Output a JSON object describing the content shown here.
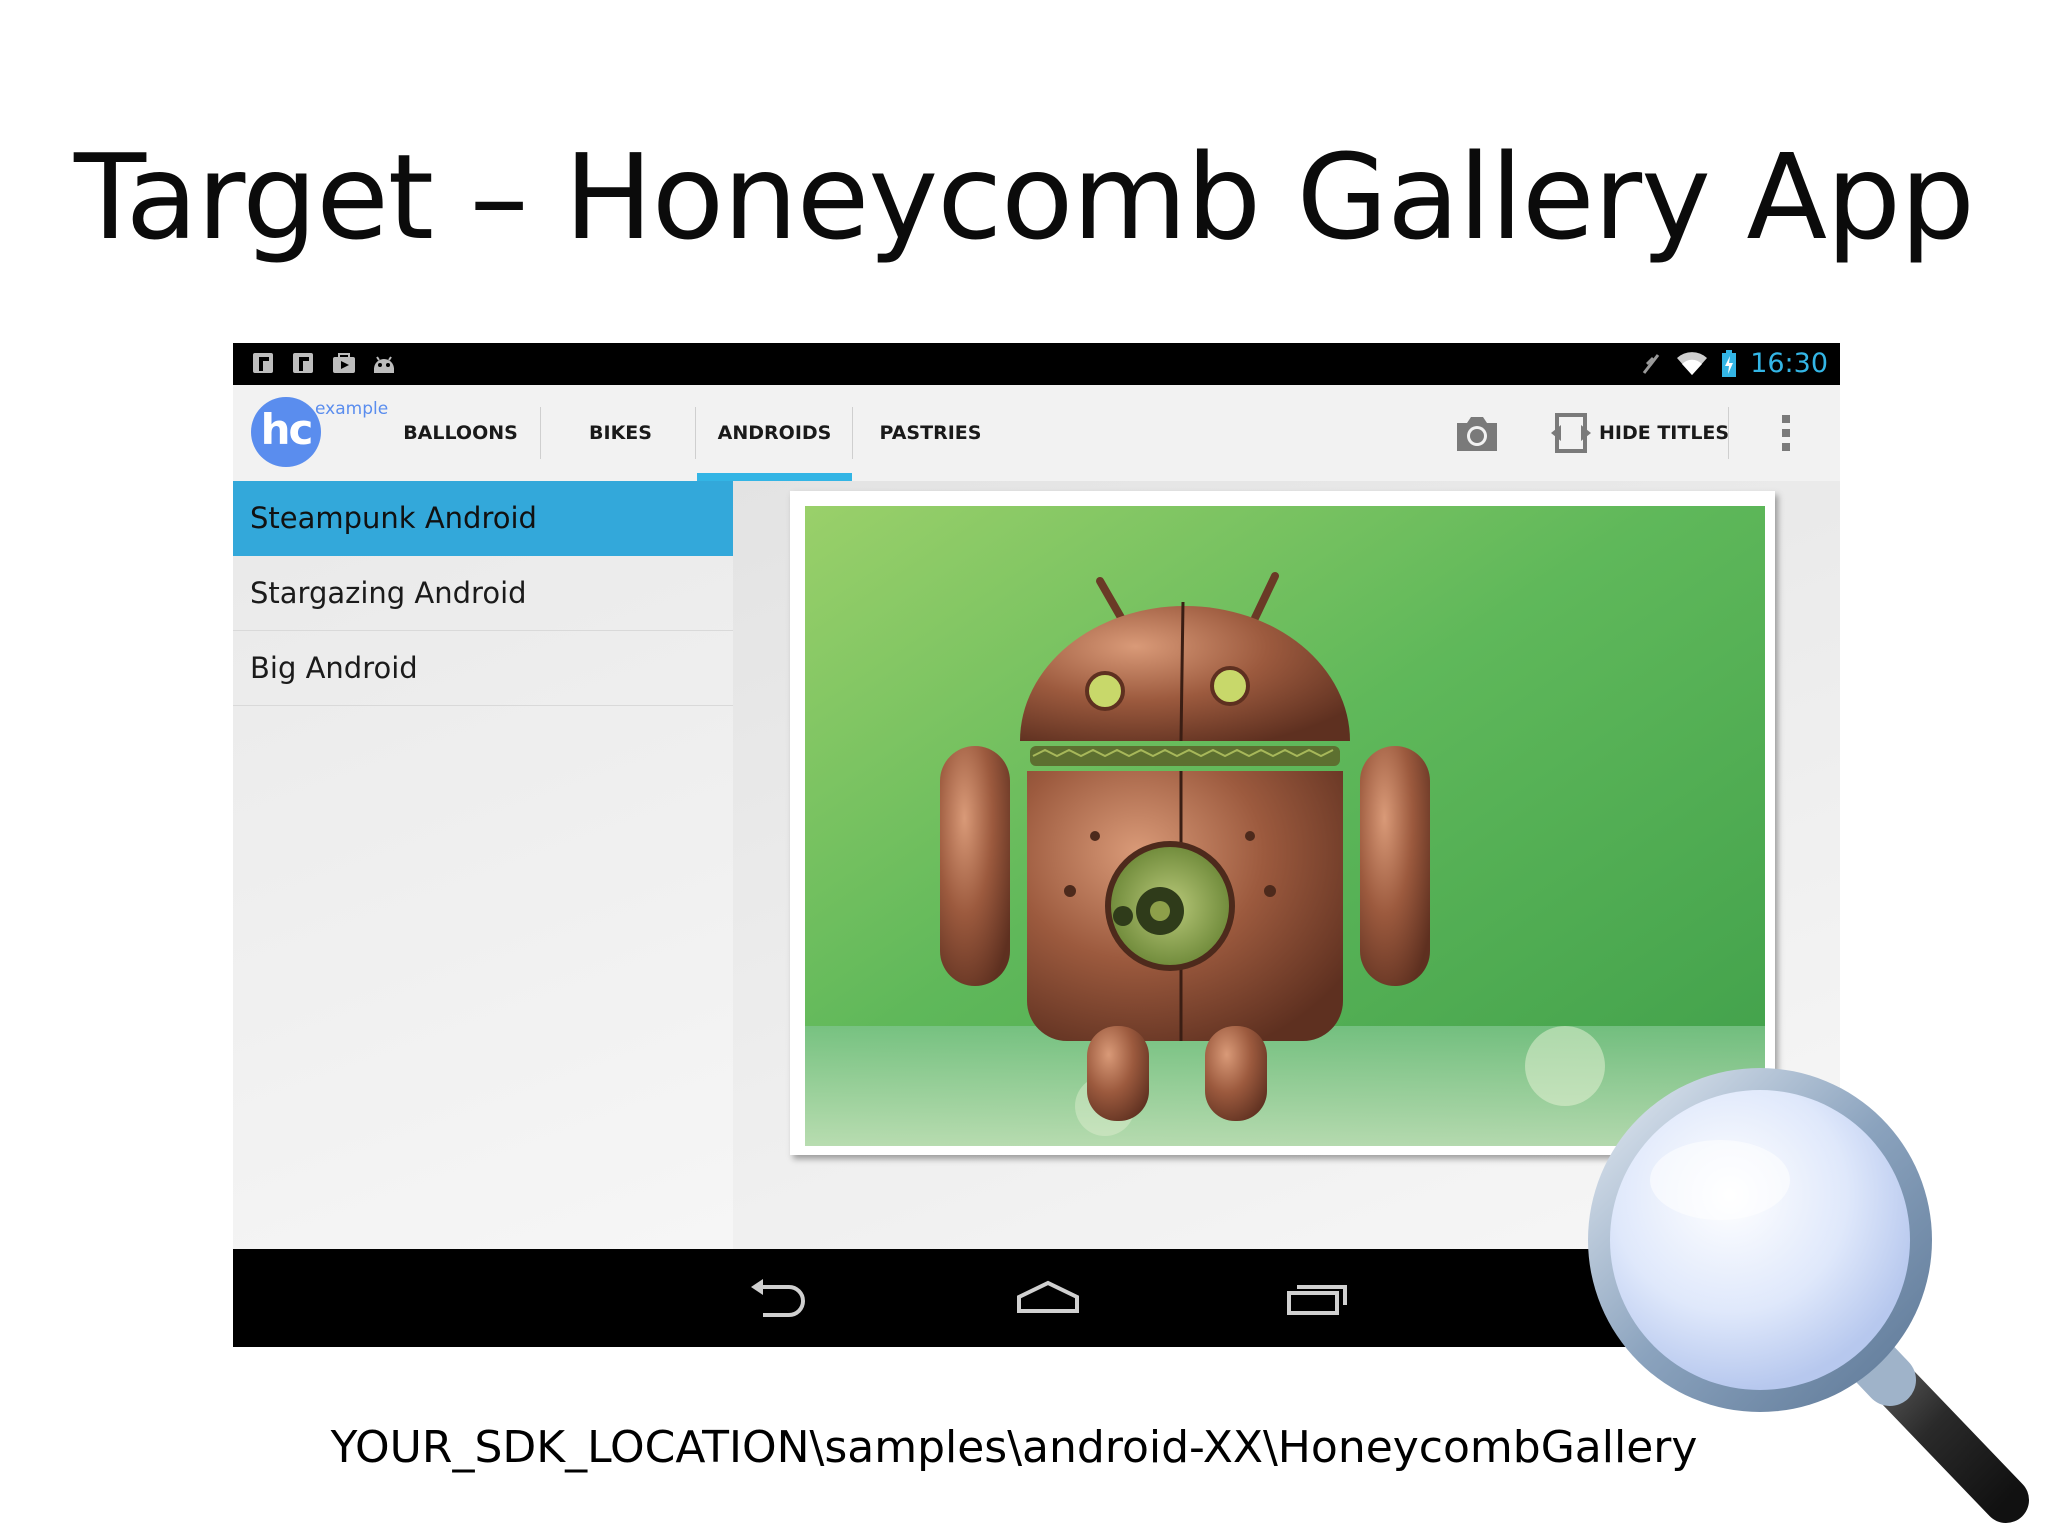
{
  "slide": {
    "title": "Target – Honeycomb Gallery App",
    "path": "YOUR_SDK_LOCATION\\samples\\android-XX\\HoneycombGallery"
  },
  "status_bar": {
    "time": "16:30",
    "notification_icons": [
      "notification-icon",
      "notification-icon",
      "shopping-bag-icon",
      "android-bugdroid-icon"
    ],
    "accent_color": "#33b5e5"
  },
  "action_bar": {
    "logo_text": "hc",
    "logo_subtext": "example",
    "tabs": [
      {
        "label": "BALLOONS",
        "selected": false
      },
      {
        "label": "BIKES",
        "selected": false
      },
      {
        "label": "ANDROIDS",
        "selected": true
      },
      {
        "label": "PASTRIES",
        "selected": false
      }
    ],
    "hide_titles_label": "HIDE TITLES"
  },
  "list": {
    "items": [
      {
        "label": "Steampunk Android",
        "selected": true
      },
      {
        "label": "Stargazing Android",
        "selected": false
      },
      {
        "label": "Big Android",
        "selected": false
      }
    ],
    "selected_color": "#33a8da"
  }
}
